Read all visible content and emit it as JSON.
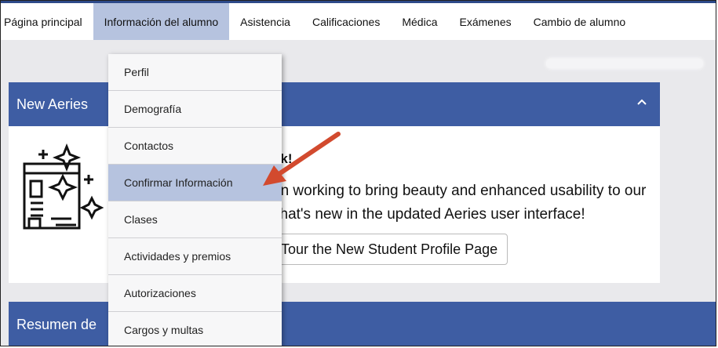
{
  "nav": {
    "items": [
      {
        "label": "Página principal"
      },
      {
        "label": "Información del alumno",
        "active": true
      },
      {
        "label": "Asistencia"
      },
      {
        "label": "Calificaciones"
      },
      {
        "label": "Médica"
      },
      {
        "label": "Exámenes"
      },
      {
        "label": "Cambio de alumno"
      }
    ]
  },
  "dropdown": {
    "items": [
      {
        "label": "Perfil"
      },
      {
        "label": "Demografía"
      },
      {
        "label": "Contactos"
      },
      {
        "label": "Confirmar Información",
        "highlighted": true
      },
      {
        "label": "Clases"
      },
      {
        "label": "Actividades y premios"
      },
      {
        "label": "Autorizaciones"
      },
      {
        "label": "Cargos y multas"
      }
    ]
  },
  "card1": {
    "title": "New Aeries",
    "line1": "ok!",
    "line2": "en working to bring beauty and enhanced usability to our",
    "line3": "vhat's new in the updated Aeries user interface!",
    "button": "Tour the New Student Profile Page"
  },
  "card2": {
    "title": "Resumen de"
  },
  "colors": {
    "header_blue": "#3e5da3",
    "active_highlight": "#b6c3df",
    "arrow_red": "#d24a2e"
  }
}
